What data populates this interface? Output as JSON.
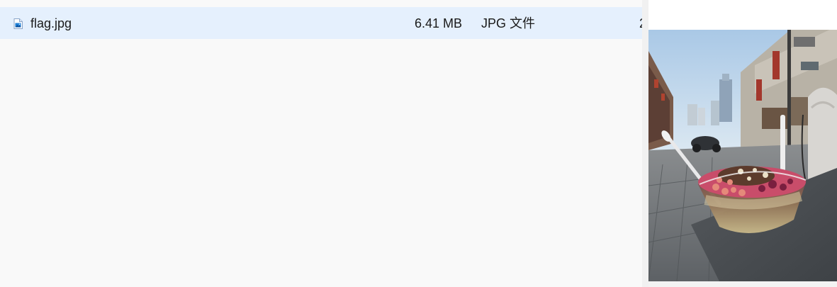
{
  "file_list": {
    "selected_item": {
      "name": "flag.jpg",
      "size": "6.41 MB",
      "type": "JPG 文件",
      "date_partial": "2",
      "icon": "image-file-icon"
    }
  },
  "preview": {
    "image_subject": "photo-preview-icon"
  },
  "colors": {
    "selected_row": "#e5f0fd",
    "pane_background": "#f9f9f9"
  }
}
